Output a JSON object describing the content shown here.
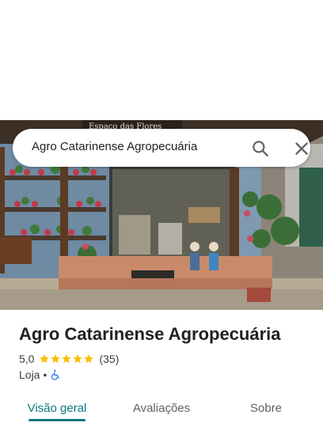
{
  "search": {
    "query": "Agro Catarinense Agropecuária",
    "search_icon": "search-icon",
    "close_icon": "close-icon"
  },
  "photo": {
    "sign_text": "Espaço das Flores"
  },
  "place": {
    "title": "Agro Catarinense Agropecuária",
    "rating": "5,0",
    "stars": 5,
    "review_count": "(35)",
    "category": "Loja",
    "separator": "•",
    "accessibility_icon": "wheelchair-icon"
  },
  "tabs": [
    {
      "label": "Visão geral",
      "active": true
    },
    {
      "label": "Avaliações",
      "active": false
    },
    {
      "label": "Sobre",
      "active": false
    }
  ],
  "colors": {
    "accent": "#0b7a80",
    "star": "#fbbc04",
    "accessibility": "#1a73e8"
  }
}
